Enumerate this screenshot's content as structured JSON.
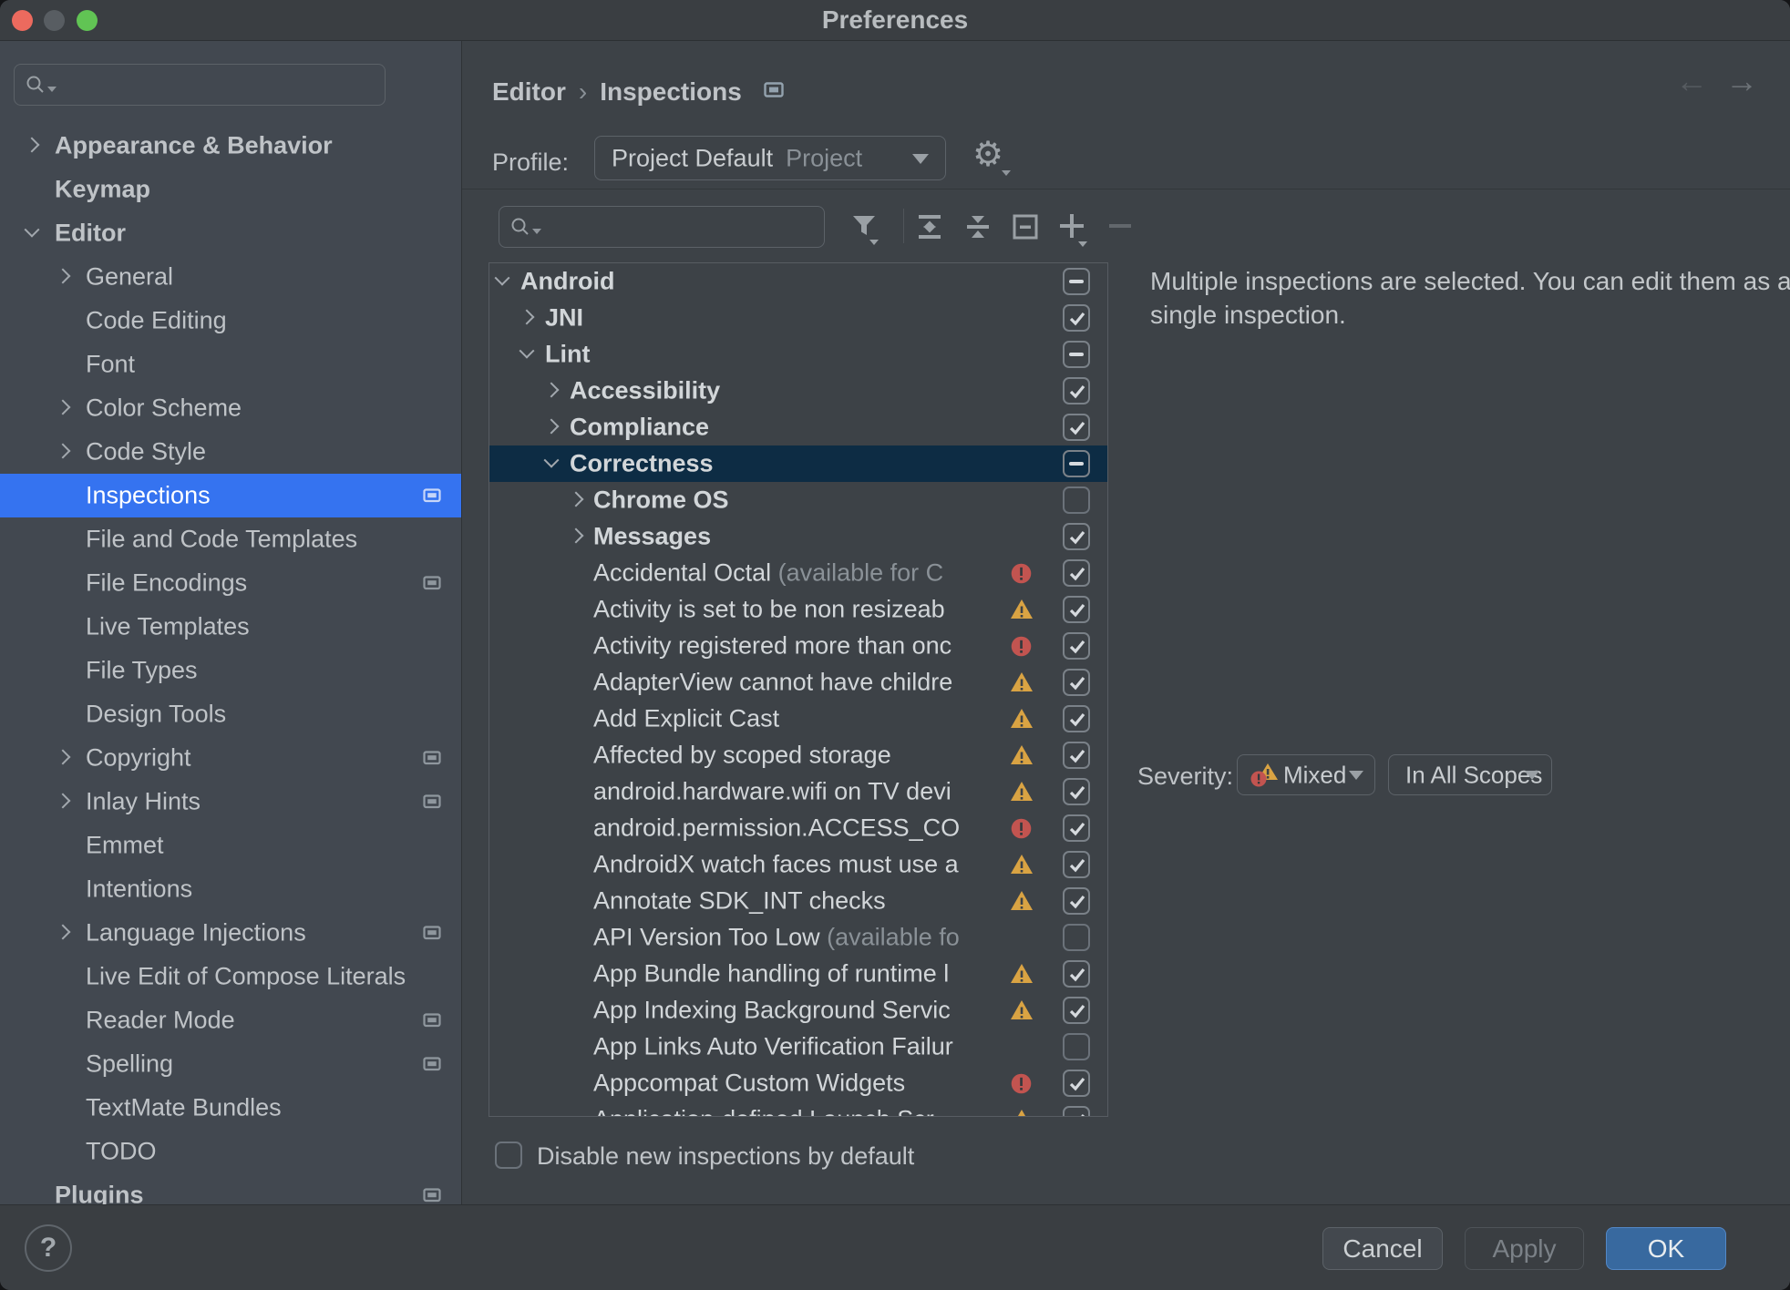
{
  "window": {
    "title": "Preferences",
    "controls": [
      "close-icon",
      "minimize-icon",
      "zoom-icon"
    ]
  },
  "colors": {
    "accent_blue": "#3573f0",
    "tree_selection": "#0d2c44",
    "warning": "#d9a343",
    "error": "#c25450",
    "ok_button": "#38699f"
  },
  "sidebar": {
    "search": {
      "value": "",
      "placeholder": ""
    },
    "items": [
      {
        "label": "Appearance & Behavior",
        "level": 0,
        "bold": true,
        "chevron": "collapsed"
      },
      {
        "label": "Keymap",
        "level": 0,
        "bold": true
      },
      {
        "label": "Editor",
        "level": 0,
        "bold": true,
        "chevron": "expanded"
      },
      {
        "label": "General",
        "level": 1,
        "chevron": "collapsed"
      },
      {
        "label": "Code Editing",
        "level": 1
      },
      {
        "label": "Font",
        "level": 1
      },
      {
        "label": "Color Scheme",
        "level": 1,
        "chevron": "collapsed"
      },
      {
        "label": "Code Style",
        "level": 1,
        "chevron": "collapsed"
      },
      {
        "label": "Inspections",
        "level": 1,
        "selected": true,
        "winicon": true
      },
      {
        "label": "File and Code Templates",
        "level": 1
      },
      {
        "label": "File Encodings",
        "level": 1,
        "winicon": true
      },
      {
        "label": "Live Templates",
        "level": 1
      },
      {
        "label": "File Types",
        "level": 1
      },
      {
        "label": "Design Tools",
        "level": 1
      },
      {
        "label": "Copyright",
        "level": 1,
        "chevron": "collapsed",
        "winicon": true
      },
      {
        "label": "Inlay Hints",
        "level": 1,
        "chevron": "collapsed",
        "winicon": true
      },
      {
        "label": "Emmet",
        "level": 1
      },
      {
        "label": "Intentions",
        "level": 1
      },
      {
        "label": "Language Injections",
        "level": 1,
        "chevron": "collapsed",
        "winicon": true
      },
      {
        "label": "Live Edit of Compose Literals",
        "level": 1
      },
      {
        "label": "Reader Mode",
        "level": 1,
        "winicon": true
      },
      {
        "label": "Spelling",
        "level": 1,
        "winicon": true
      },
      {
        "label": "TextMate Bundles",
        "level": 1
      },
      {
        "label": "TODO",
        "level": 1
      },
      {
        "label": "Plugins",
        "level": 0,
        "bold": true,
        "winicon": true
      }
    ]
  },
  "header": {
    "breadcrumb": [
      "Editor",
      "Inspections"
    ],
    "profile_label": "Profile:",
    "profile_value": "Project Default",
    "profile_scope": "Project"
  },
  "toolbar": {
    "search": {
      "value": "",
      "placeholder": ""
    },
    "icons": [
      "filter-funnel",
      "expand-all",
      "collapse-all",
      "reset-inspection",
      "add-inspection",
      "remove-inspection"
    ]
  },
  "tree": {
    "rows": [
      {
        "label": "Android",
        "level": 0,
        "bold": true,
        "chevron": "expanded",
        "state": "indeterminate"
      },
      {
        "label": "JNI",
        "level": 1,
        "bold": true,
        "chevron": "collapsed",
        "state": "checked"
      },
      {
        "label": "Lint",
        "level": 1,
        "bold": true,
        "chevron": "expanded",
        "state": "indeterminate"
      },
      {
        "label": "Accessibility",
        "level": 2,
        "bold": true,
        "chevron": "collapsed",
        "state": "checked"
      },
      {
        "label": "Compliance",
        "level": 2,
        "bold": true,
        "chevron": "collapsed",
        "state": "checked"
      },
      {
        "label": "Correctness",
        "level": 2,
        "bold": true,
        "chevron": "expanded",
        "state": "indeterminate",
        "selected": true
      },
      {
        "label": "Chrome OS",
        "level": 3,
        "bold": true,
        "chevron": "collapsed",
        "state": "unchecked"
      },
      {
        "label": "Messages",
        "level": 3,
        "bold": true,
        "chevron": "collapsed",
        "state": "checked"
      },
      {
        "label": "Accidental Octal",
        "suffix": "(available for C",
        "level": 3,
        "icon": "error",
        "state": "checked"
      },
      {
        "label": "Activity is set to be non resizeab",
        "level": 3,
        "icon": "warning",
        "state": "checked"
      },
      {
        "label": "Activity registered more than onc",
        "level": 3,
        "icon": "error",
        "state": "checked"
      },
      {
        "label": "AdapterView cannot have childre",
        "level": 3,
        "icon": "warning",
        "state": "checked"
      },
      {
        "label": "Add Explicit Cast",
        "level": 3,
        "icon": "warning",
        "state": "checked"
      },
      {
        "label": "Affected by scoped storage",
        "level": 3,
        "icon": "warning",
        "state": "checked"
      },
      {
        "label": "android.hardware.wifi on TV devi",
        "level": 3,
        "icon": "warning",
        "state": "checked"
      },
      {
        "label": "android.permission.ACCESS_CO",
        "level": 3,
        "icon": "error",
        "state": "checked"
      },
      {
        "label": "AndroidX watch faces must use a",
        "level": 3,
        "icon": "warning",
        "state": "checked"
      },
      {
        "label": "Annotate SDK_INT checks",
        "level": 3,
        "icon": "warning",
        "state": "checked"
      },
      {
        "label": "API Version Too Low",
        "suffix": "(available fo",
        "level": 3,
        "state": "unchecked"
      },
      {
        "label": "App Bundle handling of runtime l",
        "level": 3,
        "icon": "warning",
        "state": "checked"
      },
      {
        "label": "App Indexing Background Servic",
        "level": 3,
        "icon": "warning",
        "state": "checked"
      },
      {
        "label": "App Links Auto Verification Failur",
        "level": 3,
        "state": "unchecked"
      },
      {
        "label": "Appcompat Custom Widgets",
        "level": 3,
        "icon": "error",
        "state": "checked"
      },
      {
        "label": "Application-defined Launch Scr",
        "level": 3,
        "icon": "warning",
        "state": "checked"
      }
    ]
  },
  "details": {
    "message": "Multiple inspections are selected. You can edit them as a single inspection.",
    "severity_label": "Severity:",
    "severity_value": "Mixed",
    "scope_value": "In All Scopes"
  },
  "footer": {
    "disable_label": "Disable new inspections by default",
    "help": "?",
    "cancel": "Cancel",
    "apply": "Apply",
    "ok": "OK"
  }
}
